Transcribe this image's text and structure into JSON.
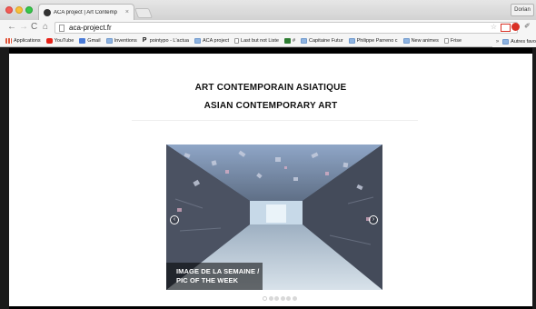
{
  "browser": {
    "tab_title": "ACA project | Art Contemp",
    "tab_close": "×",
    "profile_name": "Dorian",
    "url": "aca-project.fr",
    "nav_back": "←",
    "nav_forward": "→",
    "nav_reload": "C",
    "nav_home": "⌂",
    "star": "☆",
    "search": "Q",
    "ext_tool": "✐"
  },
  "bookmarks": [
    {
      "label": "Applications",
      "icon": "apps-grid-icon"
    },
    {
      "label": "YouTube",
      "icon": "youtube-icon"
    },
    {
      "label": "Gmail",
      "icon": "gmail-icon"
    },
    {
      "label": "Inventions",
      "icon": "folder-icon"
    },
    {
      "label": "pointypo - L'actua",
      "icon": "p-icon"
    },
    {
      "label": "ACA project",
      "icon": "folder-icon"
    },
    {
      "label": "Last but not Liste",
      "icon": "doc-icon"
    },
    {
      "label": "#",
      "icon": "green-icon"
    },
    {
      "label": "Capitaine Futur",
      "icon": "folder-icon"
    },
    {
      "label": "Philippe Parreno c",
      "icon": "folder-icon"
    },
    {
      "label": "New animes",
      "icon": "folder-icon"
    },
    {
      "label": "Frise",
      "icon": "doc-icon"
    }
  ],
  "bookmarks_more": "»",
  "bookmarks_other": "Autres favo",
  "page": {
    "title_fr": "ART CONTEMPORAIN ASIATIQUE",
    "title_en": "ASIAN CONTEMPORARY ART",
    "carousel": {
      "caption_line1": "IMAGE DE LA SEMAINE /",
      "caption_line2": "PIC OF THE WEEK",
      "prev": "‹",
      "next": "›",
      "slide_count": 6,
      "active_slide": 1
    }
  },
  "colors": {
    "accent_red": "#d93025",
    "page_bg": "#ffffff",
    "frame": "#000000"
  }
}
